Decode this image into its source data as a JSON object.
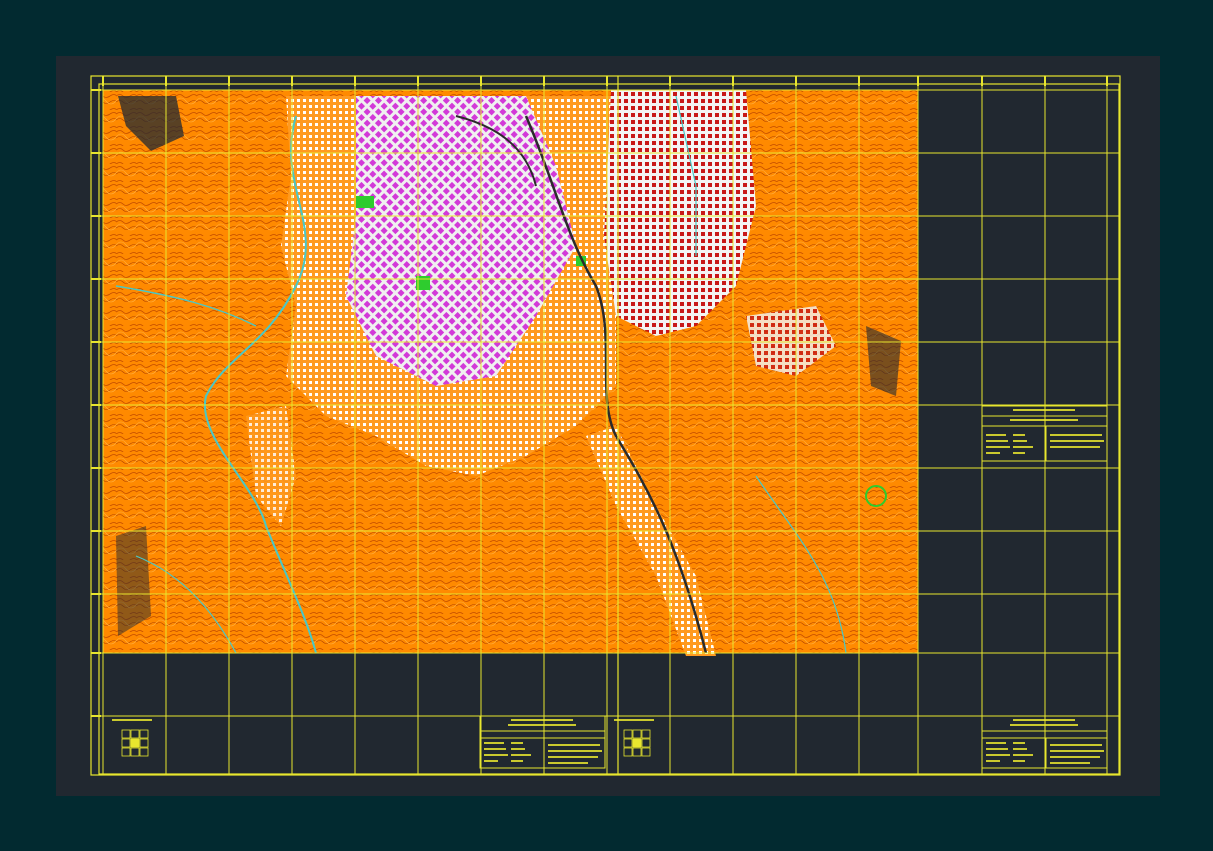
{
  "drawing": {
    "colors": {
      "app_background": "#022a30",
      "paper": "#212830",
      "frame": "#e8e62e",
      "terrain": "#ff8a00",
      "contour_dark": "#c24a00",
      "river": "#49c8c6",
      "urban_magenta": "#d23ad8",
      "urban_red": "#d61a1a",
      "urban_white": "#f2f2f2",
      "park": "#2ecc2e"
    },
    "sheets": [
      {
        "name": "left-sheet",
        "grid_row_labels": [],
        "scale_bar_label": "",
        "index_grid": "3x3",
        "title_block": {
          "title": "",
          "subtitle": "",
          "fields": []
        }
      },
      {
        "name": "right-sheet",
        "grid_row_labels": [],
        "scale_bar_label": "",
        "index_grid": "3x3",
        "title_block": {
          "title": "",
          "subtitle": "",
          "fields": []
        }
      }
    ],
    "legend_block": {
      "title": "",
      "fields": []
    }
  }
}
